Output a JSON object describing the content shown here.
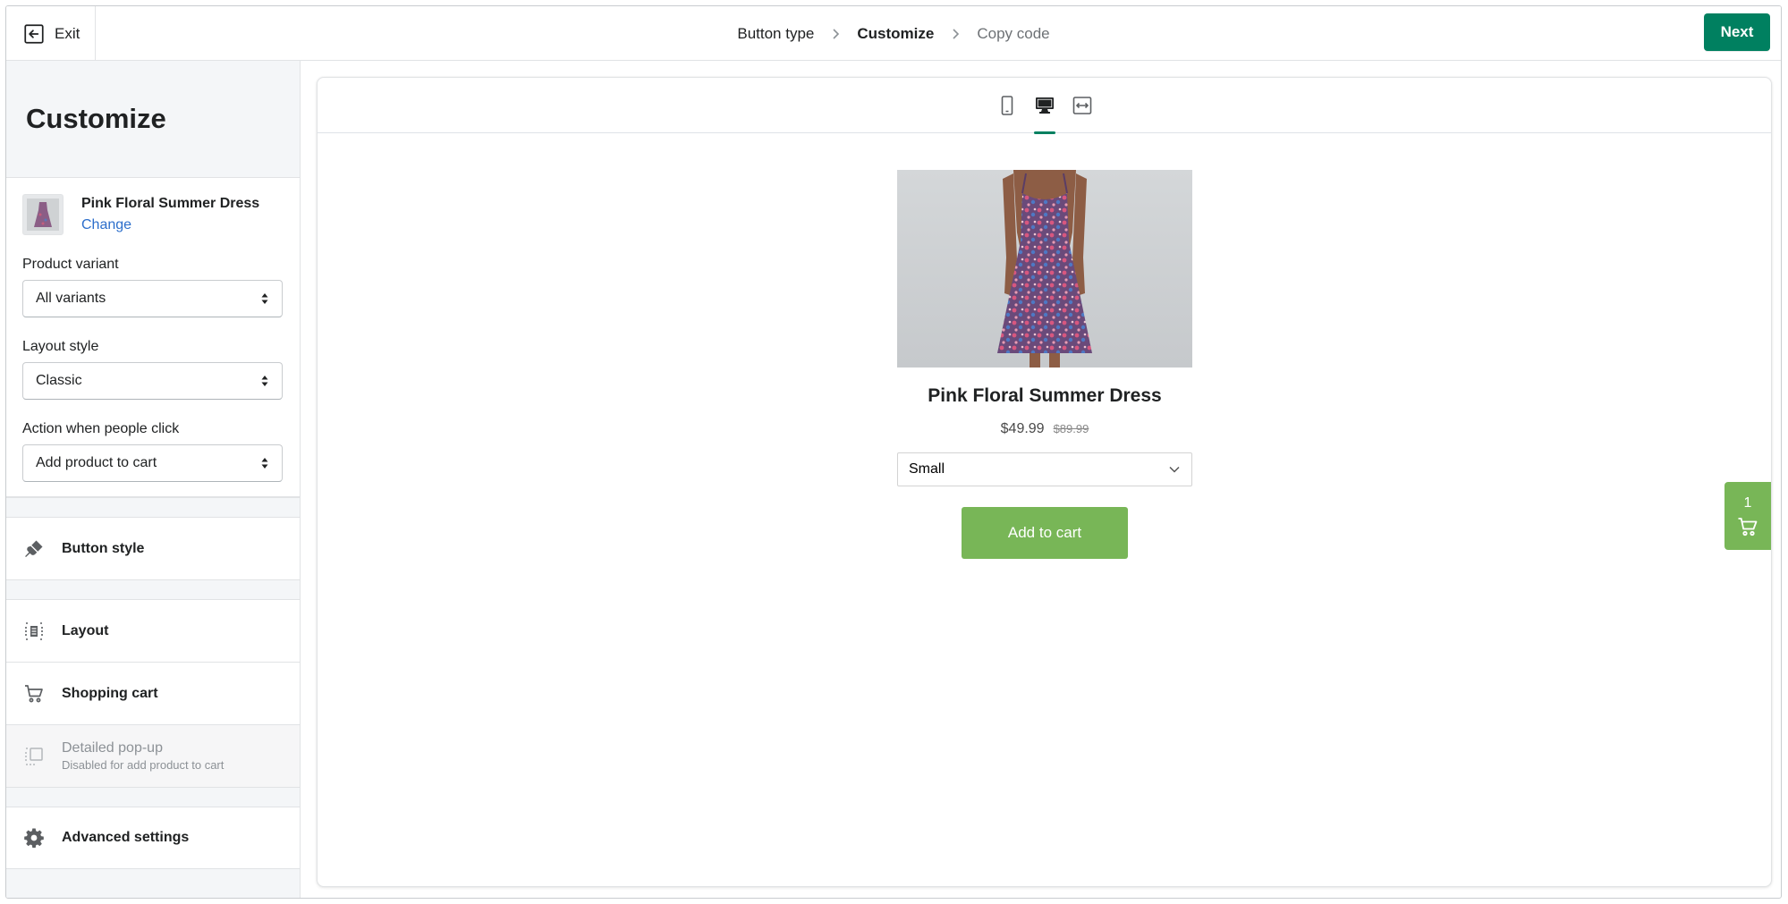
{
  "topbar": {
    "exit_label": "Exit",
    "breadcrumbs": [
      {
        "label": "Button type"
      },
      {
        "label": "Customize"
      },
      {
        "label": "Copy code"
      }
    ],
    "next_label": "Next"
  },
  "sidebar": {
    "title": "Customize",
    "product": {
      "name": "Pink Floral Summer Dress",
      "change_label": "Change"
    },
    "fields": {
      "variant_label": "Product variant",
      "variant_value": "All variants",
      "layout_label": "Layout style",
      "layout_value": "Classic",
      "action_label": "Action when people click",
      "action_value": "Add product to cart"
    },
    "items": {
      "button_style": "Button style",
      "layout": "Layout",
      "shopping_cart": "Shopping cart",
      "popup": "Detailed pop-up",
      "popup_sub": "Disabled for add product to cart",
      "advanced": "Advanced settings"
    }
  },
  "preview": {
    "product_title": "Pink Floral Summer Dress",
    "price": "$49.99",
    "compare_price": "$89.99",
    "variant_selected": "Small",
    "add_to_cart_label": "Add to cart",
    "cart_count": "1"
  },
  "colors": {
    "primary": "#008060",
    "link": "#2c6ecb",
    "buy_button": "#78b657"
  }
}
